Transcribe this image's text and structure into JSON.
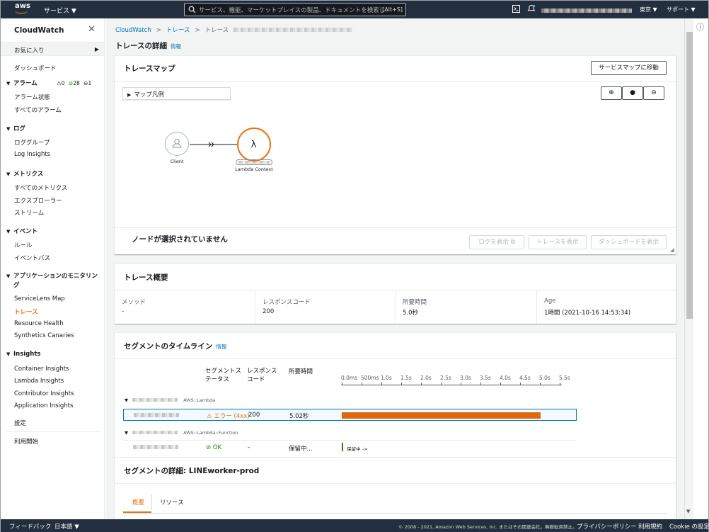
{
  "topbar": {
    "logo_text": "aws",
    "services_label": "サービス ▼",
    "search_placeholder": "サービス、機能、マーケットプレイスの製品、ドキュメントを検索し",
    "search_shortcut": "[Alt+S]",
    "region_label": "東京 ▼",
    "support_label": "サポート ▼"
  },
  "sidebar": {
    "title": "CloudWatch",
    "favorites_label": "お気に入り",
    "dashboard": "ダッシュボード",
    "alarms_header": "アラーム",
    "alarm_counts": {
      "alarm": "0",
      "ok": "28",
      "insufficient": "1"
    },
    "alarm_state": "アラーム状態",
    "all_alarms": "すべてのアラーム",
    "logs_header": "ログ",
    "log_groups": "ロググループ",
    "logs_insights": "Log Insights",
    "metrics_header": "メトリクス",
    "all_metrics": "すべてのメトリクス",
    "explorer": "エクスプローラー",
    "streams": "ストリーム",
    "events_header": "イベント",
    "rules": "ルール",
    "event_bus": "イベントバス",
    "appmon_header_1": "アプリケーションのモニタリン",
    "appmon_header_2": "グ",
    "servicelens": "ServiceLens Map",
    "traces": "トレース",
    "resource_health": "Resource Health",
    "synthetics": "Synthetics Canaries",
    "insights_header": "Insights",
    "container_insights": "Container Insights",
    "lambda_insights": "Lambda Insights",
    "contributor_insights": "Contributor Insights",
    "application_insights": "Application Insights",
    "settings": "設定",
    "getting_started": "利用開始"
  },
  "breadcrumb": {
    "root": "CloudWatch",
    "traces": "トレース",
    "current": "トレース"
  },
  "page": {
    "title": "トレースの詳細",
    "info": "情報"
  },
  "trace_map": {
    "title": "トレースマップ",
    "service_map_button": "サービスマップに移動",
    "legend_label": "マップ凡例",
    "client_label": "Client",
    "lambda_label": "Lambda Context",
    "no_node": "ノードが選択されていません",
    "view_logs": "ログを表示",
    "view_traces": "トレースを表示",
    "view_dashboard": "ダッシュボードを表示"
  },
  "summary": {
    "title": "トレース概要",
    "method_label": "メソッド",
    "method_value": "-",
    "response_label": "レスポンスコード",
    "response_value": "200",
    "duration_label": "所要時間",
    "duration_value": "5.0秒",
    "age_label": "Age",
    "age_value": "1時間 (2021-10-16 14:53:34)"
  },
  "timeline": {
    "title": "セグメントのタイムライン",
    "info": "情報",
    "col_status_1": "セグメントス",
    "col_status_2": "テータス",
    "col_response_1": "レスポンス",
    "col_response_2": "コード",
    "col_duration": "所要時間",
    "ticks": [
      "0.0ms",
      "500ms",
      "1.0s",
      "1.5s",
      "2.0s",
      "2.5s",
      "3.0s",
      "3.5s",
      "4.0s",
      "4.5s",
      "5.0s",
      "5.5s"
    ],
    "group1_type": "AWS::Lambda",
    "row1": {
      "status": "エラー (4xx)",
      "response": "200",
      "duration": "5.02秒",
      "duration_seconds": 5.02
    },
    "group2_type": "AWS::Lambda::Function",
    "row2": {
      "status": "OK",
      "response": "-",
      "duration": "保留中...",
      "bar_label": "保留中 ->"
    }
  },
  "details": {
    "title": "セグメントの詳細: LINEworker-prod",
    "tab_overview": "概要",
    "tab_resources": "リソース"
  },
  "footer": {
    "feedback": "フィードバック",
    "language": "日本語 ▼",
    "copyright": "© 2008 - 2021, Amazon Web Services, Inc. またはその関連会社。無断転用禁止。",
    "privacy": "プライバシーポリシー",
    "terms": "利用規約",
    "cookie": "Cookie の設定"
  },
  "colors": {
    "nav_bg": "#232f3e",
    "accent": "#ec7211",
    "link": "#0073bb",
    "ok": "#1d8102"
  }
}
